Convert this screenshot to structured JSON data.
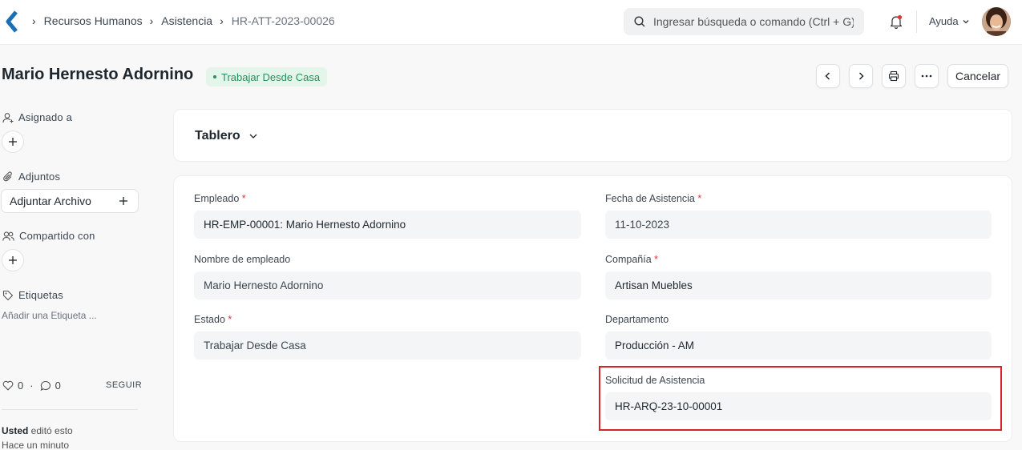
{
  "navbar": {
    "breadcrumbs": [
      "Recursos Humanos",
      "Asistencia",
      "HR-ATT-2023-00026"
    ],
    "search_placeholder": "Ingresar búsqueda o comando (Ctrl + G)",
    "help_label": "Ayuda"
  },
  "header": {
    "title": "Mario Hernesto Adornino",
    "status": "Trabajar Desde Casa",
    "status_color": "#278f5e",
    "cancel_label": "Cancelar"
  },
  "sidebar": {
    "assigned_label": "Asignado a",
    "attachments_label": "Adjuntos",
    "attach_button_label": "Adjuntar Archivo",
    "shared_label": "Compartido con",
    "tags_label": "Etiquetas",
    "add_tag_label": "Añadir una Etiqueta ...",
    "likes_count": "0",
    "comments_count": "0",
    "follow_label": "SEGUIR",
    "activity_user": "Usted",
    "activity_text": " editó esto",
    "activity_time": "Hace un minuto"
  },
  "dashboard": {
    "title": "Tablero"
  },
  "form": {
    "employee": {
      "label": "Empleado",
      "value": "HR-EMP-00001: Mario Hernesto Adornino"
    },
    "attendance_date": {
      "label": "Fecha de Asistencia",
      "value": "11-10-2023"
    },
    "employee_name": {
      "label": "Nombre de empleado",
      "value": "Mario Hernesto Adornino"
    },
    "company": {
      "label": "Compañía",
      "value": "Artisan Muebles"
    },
    "status": {
      "label": "Estado",
      "value": "Trabajar Desde Casa"
    },
    "department": {
      "label": "Departamento",
      "value": "Producción - AM"
    },
    "attendance_request": {
      "label": "Solicitud de Asistencia",
      "value": "HR-ARQ-23-10-00001"
    }
  },
  "highlight_color": "#d92128"
}
